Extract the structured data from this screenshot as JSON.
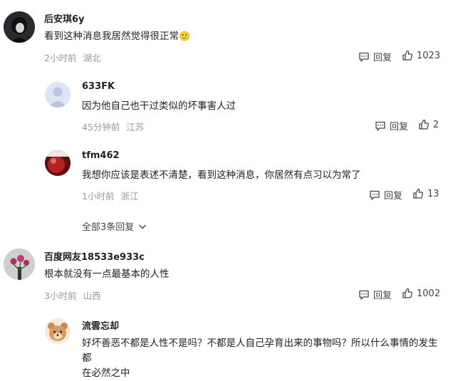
{
  "comments": [
    {
      "name": "后安琪6y",
      "text": "看到这种消息我居然觉得很正常",
      "emoji": "🙂",
      "time": "2小时前",
      "location": "湖北",
      "reply_label": "回复",
      "likes": "1023"
    },
    {
      "name": "633FK",
      "text": "因为他自己也干过类似的坏事害人过",
      "time": "45分钟前",
      "location": "江苏",
      "reply_label": "回复",
      "likes": "2"
    },
    {
      "name": "tfm462",
      "text": "我想你应该是表述不清楚，看到这种消息，你居然有点习以为常了",
      "time": "1小时前",
      "location": "浙江",
      "reply_label": "回复",
      "likes": "13"
    },
    {
      "name": "百度网友18533e933c",
      "text": "根本就没有一点最基本的人性",
      "time": "3小时前",
      "location": "山西",
      "reply_label": "回复",
      "likes": "1002"
    },
    {
      "name": "流雲忘却",
      "text_line1": "好坏善恶不都是人性不是吗？不都是人自己孕育出来的事物吗？所以什么事情的发生都",
      "text_line2": "在必然之中"
    }
  ],
  "expand_replies": "全部3条回复",
  "colors": {
    "meta": "#9a9a9a",
    "text": "#222222",
    "icon": "#444444"
  }
}
